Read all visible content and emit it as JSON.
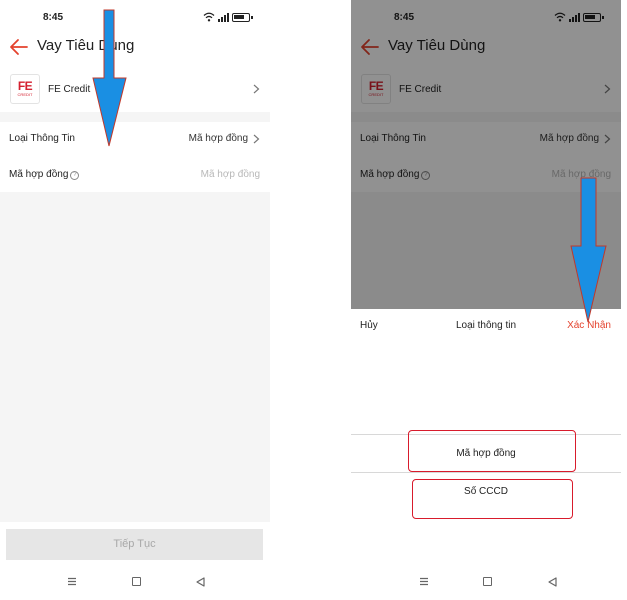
{
  "status_bar": {
    "time": "8:45"
  },
  "header": {
    "title": "Vay Tiêu Dùng"
  },
  "provider": {
    "logo_line1": "FE",
    "logo_line2": "CREDIT",
    "name": "FE Credit"
  },
  "form": {
    "info_type_label": "Loại Thông Tin",
    "info_type_value": "Mã hợp đồng",
    "contract_label": "Mã hợp đồng",
    "contract_placeholder": "Mã hợp đồng"
  },
  "continue_button": "Tiếp Tục",
  "picker": {
    "cancel": "Hủy",
    "title": "Loại thông tin",
    "confirm": "Xác Nhận",
    "options": [
      "Mã hợp đồng",
      "Số CCCD"
    ]
  },
  "colors": {
    "accent": "#e4422d",
    "annotation_arrow": "#1a8fe3",
    "annotation_outline": "#d81b2c"
  }
}
